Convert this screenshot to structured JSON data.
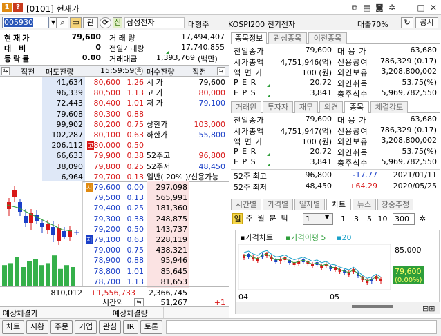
{
  "window": {
    "number_badge": "1",
    "help_badge": "?",
    "title": "[0101] 현재가"
  },
  "toolbar": {
    "stock_code": "005930",
    "tag_gwan": "관",
    "tag_sin": "신",
    "stock_name": "삼성전자",
    "category": "대형주",
    "index_name": "KOSPI200 전기전자",
    "margin": "대출70%",
    "public_button": "공시"
  },
  "quote": {
    "current_price_label": "현재가",
    "current_price": "79,600",
    "change_label": "대비",
    "change": "0",
    "rate_label": "등락률",
    "rate": "0.00",
    "volume_label": "거 래 량",
    "volume": "17,494,407",
    "prev_volume_label": "전일거래량",
    "prev_volume": "17,740,855",
    "amount_label": "거래대금",
    "amount": "1,393,769",
    "amount_unit": "(백만)"
  },
  "orderbook": {
    "headers": {
      "prev": "직전",
      "ask_qty": "매도잔량",
      "time": "15:59:59",
      "bid_qty": "매수잔량",
      "prev2": "직전"
    },
    "asks": [
      {
        "qty": "41,634",
        "price": "80,600",
        "rate": "1.26"
      },
      {
        "qty": "96,339",
        "price": "80,500",
        "rate": "1.13"
      },
      {
        "qty": "72,443",
        "price": "80,400",
        "rate": "1.01"
      },
      {
        "qty": "79,608",
        "price": "80,300",
        "rate": "0.88"
      },
      {
        "qty": "99,902",
        "price": "80,200",
        "rate": "0.75"
      },
      {
        "qty": "102,287",
        "price": "80,100",
        "rate": "0.63"
      },
      {
        "qty": "206,112",
        "price": "80,000",
        "rate": "0.50",
        "badge": "고"
      },
      {
        "qty": "66,633",
        "price": "79,900",
        "rate": "0.38"
      },
      {
        "qty": "38,090",
        "price": "79,800",
        "rate": "0.25"
      },
      {
        "qty": "6,964",
        "price": "79,700",
        "rate": "0.13"
      }
    ],
    "ask_side_info": [
      {
        "label": "시 가",
        "value": "79,600"
      },
      {
        "label": "고 가",
        "value": "80,000"
      },
      {
        "label": "저 가",
        "value": "79,100"
      },
      {
        "label": "",
        "value": ""
      },
      {
        "label": "상한가",
        "value": "103,000"
      },
      {
        "label": "하한가",
        "value": "55,800"
      },
      {
        "label": "",
        "value": ""
      },
      {
        "label": "52주고",
        "value": "96,800"
      },
      {
        "label": "52주저",
        "value": "48,450"
      },
      {
        "label": "일반( 20% )/신용가능",
        "value": ""
      }
    ],
    "bids": [
      {
        "price": "79,600",
        "rate": "0.00",
        "qty": "297,098",
        "badge": "시"
      },
      {
        "price": "79,500",
        "rate": "0.13",
        "qty": "565,991"
      },
      {
        "price": "79,400",
        "rate": "0.25",
        "qty": "181,360"
      },
      {
        "price": "79,300",
        "rate": "0.38",
        "qty": "248,875"
      },
      {
        "price": "79,200",
        "rate": "0.50",
        "qty": "143,737"
      },
      {
        "price": "79,100",
        "rate": "0.63",
        "qty": "228,119",
        "badge": "저"
      },
      {
        "price": "79,000",
        "rate": "0.75",
        "qty": "438,321"
      },
      {
        "price": "78,900",
        "rate": "0.88",
        "qty": "95,946"
      },
      {
        "price": "78,800",
        "rate": "1.01",
        "qty": "85,645"
      },
      {
        "price": "78,700",
        "rate": "1.13",
        "qty": "81,653"
      }
    ],
    "total_ask": "810,012",
    "total_diff": "+1,556,733",
    "total_bid": "2,366,745",
    "after_label": "시간외",
    "after_qty": "51,267",
    "after_diff": "+1",
    "expected_price_label": "예상체결가",
    "expected_qty_label": "예상체결량"
  },
  "right_tabs_top": [
    "종목정보",
    "관심종목",
    "이전종목"
  ],
  "info_top": {
    "left": [
      {
        "label": "전일종가",
        "value": "79,600"
      },
      {
        "label": "시가총액",
        "value": "4,751,946(억)"
      },
      {
        "label": "액 면 가",
        "value": "100 (원)"
      },
      {
        "label": "P E R",
        "value": "20.72"
      },
      {
        "label": "E P S",
        "value": "3,841"
      }
    ],
    "right": [
      {
        "label": "대 용 가",
        "value": "63,680"
      },
      {
        "label": "신용공여",
        "value": "786,329  (0.17)"
      },
      {
        "label": "외인보유",
        "value": "3,208,800,002"
      },
      {
        "label": "외인취득",
        "value": "53.75(%)"
      },
      {
        "label": "총주식수",
        "value": "5,969,782,550"
      }
    ]
  },
  "right_tabs_mid": [
    "거래원",
    "투자자",
    "재무",
    "의견",
    "종목",
    "체결강도"
  ],
  "info_mid": {
    "left": [
      {
        "label": "전일종가",
        "value": "79,600"
      },
      {
        "label": "시가총액",
        "value": "4,751,947(억)"
      },
      {
        "label": "액 면 가",
        "value": "100 (원)"
      },
      {
        "label": "P E R",
        "value": "20.72"
      },
      {
        "label": "E P S",
        "value": "3,841"
      }
    ],
    "right": [
      {
        "label": "대 용 가",
        "value": "63,680"
      },
      {
        "label": "신용공여",
        "value": "786,329  (0.17)"
      },
      {
        "label": "외인보유",
        "value": "3,208,800,002"
      },
      {
        "label": "외인취득",
        "value": "53.75(%)"
      },
      {
        "label": "총주식수",
        "value": "5,969,782,550"
      }
    ]
  },
  "week52": [
    {
      "label": "52주 최고",
      "price": "96,800",
      "diff": "-17.77",
      "date": "2021/01/11"
    },
    {
      "label": "52주 최저",
      "price": "48,450",
      "diff": "+64.29",
      "date": "2020/05/25"
    }
  ],
  "chart_tabs": [
    "시간별",
    "가격별",
    "일자별",
    "차트",
    "뉴스",
    "장중추정"
  ],
  "chart_controls": {
    "periods": [
      "일",
      "주",
      "월",
      "분",
      "틱"
    ],
    "counts": [
      "1",
      "3",
      "5",
      "10"
    ],
    "bars": "300"
  },
  "chart_data": {
    "type": "candlestick",
    "legend": [
      "가격차트",
      "가격이평 5",
      "20"
    ],
    "y_tick": "85,000",
    "current_price": "79,600",
    "current_rate": "(0.00%)",
    "x_ticks": [
      "04",
      "05"
    ],
    "colors": {
      "up": "#d81818",
      "down": "#1a3fc8",
      "ma5": "#2e9e3a",
      "ma20": "#1aa0c8"
    }
  },
  "bottom_buttons": [
    "차트",
    "시황",
    "주문",
    "기업",
    "관심",
    "IR",
    "토론"
  ]
}
